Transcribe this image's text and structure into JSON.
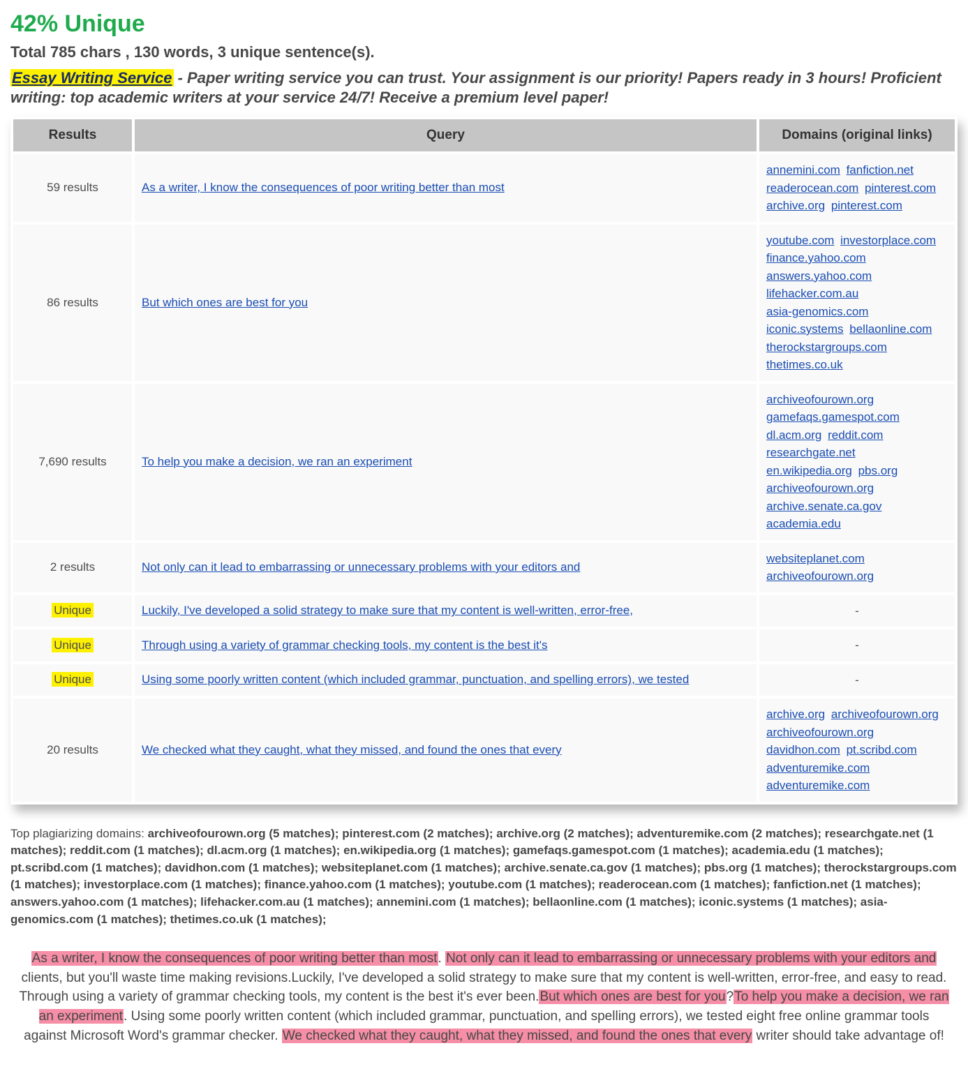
{
  "header": {
    "unique_pct": "42% Unique",
    "stats": "Total 785 chars , 130 words, 3 unique sentence(s).",
    "sponsor_link_text": "Essay Writing Service",
    "sponsor_text_rest": " - Paper writing service you can trust. Your assignment is our priority! Papers ready in 3 hours! Proficient writing: top academic writers at your service 24/7! Receive a premium level paper!"
  },
  "columns": {
    "results": "Results",
    "query": "Query",
    "domains": "Domains (original links)"
  },
  "rows": [
    {
      "results": "59 results",
      "unique": false,
      "query": "As a writer, I know the consequences of poor writing better than most",
      "domains": [
        "annemini.com",
        "fanfiction.net",
        "readerocean.com",
        "pinterest.com",
        "archive.org",
        "pinterest.com"
      ]
    },
    {
      "results": "86 results",
      "unique": false,
      "query": "But which ones are best for you",
      "domains": [
        "youtube.com",
        "investorplace.com",
        "finance.yahoo.com",
        "answers.yahoo.com",
        "lifehacker.com.au",
        "asia-genomics.com",
        "iconic.systems",
        "bellaonline.com",
        "therockstargroups.com",
        "thetimes.co.uk"
      ]
    },
    {
      "results": "7,690 results",
      "unique": false,
      "query": "To help you make a decision, we ran an experiment",
      "domains": [
        "archiveofourown.org",
        "gamefaqs.gamespot.com",
        "dl.acm.org",
        "reddit.com",
        "researchgate.net",
        "en.wikipedia.org",
        "pbs.org",
        "archiveofourown.org",
        "archive.senate.ca.gov",
        "academia.edu"
      ]
    },
    {
      "results": "2 results",
      "unique": false,
      "query": "Not only can it lead to embarrassing or unnecessary problems with your editors and",
      "domains": [
        "websiteplanet.com",
        "archiveofourown.org"
      ]
    },
    {
      "results": "Unique",
      "unique": true,
      "query": "Luckily, I've developed a solid strategy to make sure that my content is well-written, error-free,",
      "domains": []
    },
    {
      "results": "Unique",
      "unique": true,
      "query": "Through using a variety of grammar checking tools, my content is the best it's",
      "domains": []
    },
    {
      "results": "Unique",
      "unique": true,
      "query": "Using some poorly written content (which included grammar, punctuation, and spelling errors), we tested",
      "domains": []
    },
    {
      "results": "20 results",
      "unique": false,
      "query": "We checked what they caught, what they missed, and found the ones that every",
      "domains": [
        "archive.org",
        "archiveofourown.org",
        "archiveofourown.org",
        "davidhon.com",
        "pt.scribd.com",
        "adventuremike.com",
        "adventuremike.com"
      ]
    }
  ],
  "top_domains": {
    "label": "Top plagiarizing domains: ",
    "list": "archiveofourown.org (5 matches); pinterest.com (2 matches); archive.org (2 matches); adventuremike.com (2 matches); researchgate.net (1 matches); reddit.com (1 matches); dl.acm.org (1 matches); en.wikipedia.org (1 matches); gamefaqs.gamespot.com (1 matches); academia.edu (1 matches); pt.scribd.com (1 matches); davidhon.com (1 matches); websiteplanet.com (1 matches); archive.senate.ca.gov (1 matches); pbs.org (1 matches); therockstargroups.com (1 matches); investorplace.com (1 matches); finance.yahoo.com (1 matches); youtube.com (1 matches); readerocean.com (1 matches); fanfiction.net (1 matches); answers.yahoo.com (1 matches); lifehacker.com.au (1 matches); annemini.com (1 matches); bellaonline.com (1 matches); iconic.systems (1 matches); asia-genomics.com (1 matches); thetimes.co.uk (1 matches);"
  },
  "passage": [
    {
      "t": "As a writer, I know the consequences of poor writing better than most",
      "hl": true
    },
    {
      "t": ". ",
      "hl": false
    },
    {
      "t": "Not only can it lead to embarrassing or unnecessary problems with your editors and",
      "hl": true
    },
    {
      "t": " clients, but you'll waste time making revisions.Luckily, I've developed a solid strategy to make sure that my content is well-written, error-free, and easy to read. Through using a variety of grammar checking tools, my content is the best it's ever been.",
      "hl": false
    },
    {
      "t": "But which ones are best for you",
      "hl": true
    },
    {
      "t": "?",
      "hl": false
    },
    {
      "t": "To help you make a decision, we ran an experiment",
      "hl": true
    },
    {
      "t": ". Using some poorly written content (which included grammar, punctuation, and spelling errors), we tested eight free online grammar tools against Microsoft Word's grammar checker. ",
      "hl": false
    },
    {
      "t": "We checked what they caught, what they missed, and found the ones that every",
      "hl": true
    },
    {
      "t": " writer should take advantage of!",
      "hl": false
    }
  ]
}
